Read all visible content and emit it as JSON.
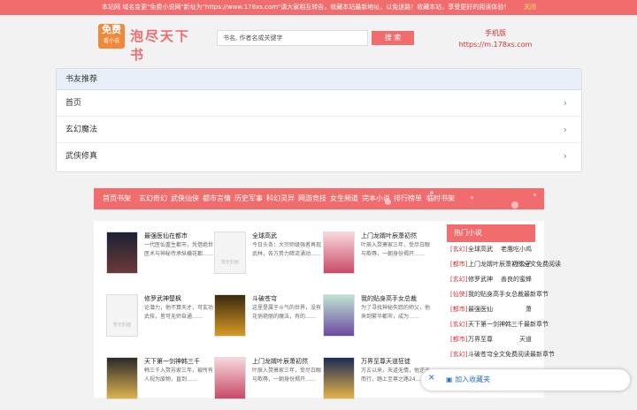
{
  "topbar": {
    "notice": "本站网 域名变更\"免费小说网\"新址为\"https://www.178xs.com\"请大家相互转告，收藏本站最新地址，以免迷路！收藏本站，享受更好的阅读体验！",
    "close": "关闭"
  },
  "logo": {
    "badge_top": "免费",
    "badge_bottom": "看小说",
    "text": "泡尽天下书"
  },
  "search": {
    "placeholder": "书名, 作者名或关键字",
    "button": "搜 索"
  },
  "mobile": {
    "label": "手机版",
    "url": "https://m.178xs.com"
  },
  "panel": {
    "title": "书友推荐",
    "rows": [
      "首页",
      "玄幻魔法",
      "武侠修真"
    ]
  },
  "nav": [
    "首页书架",
    "玄幻奇幻",
    "武侠仙侠",
    "都市言情",
    "历史军事",
    "科幻灵异",
    "网游竞技",
    "女生频道",
    "完本小说",
    "排行榜单",
    "临时书架"
  ],
  "books": [
    {
      "title": "最强医仙在都市",
      "desc": "一代医仙重生都市，凭借绝世医术与神秘传承纵横花都……",
      "cover": "dark"
    },
    {
      "title": "全球高武",
      "desc": "今日头条：大宗师级强者再现武林，各方势力暗流涌动……",
      "cover": "blank"
    },
    {
      "title": "上门龙婿叶辰萧初然",
      "desc": "叶辰入赘萧家三年，受尽白眼与欺辱，一朝身份揭开……",
      "cover": "pink"
    },
    {
      "title": "修罗武神楚枫",
      "desc": "论潜力，他不算天才，可玄功武技，皆可无师自通……",
      "cover": "blank"
    },
    {
      "title": "斗破苍穹",
      "desc": "这里是属于斗气的世界，没有花俏艳丽的魔法，有的……",
      "cover": "gold"
    },
    {
      "title": "我的贴身高手女总裁",
      "desc": "为了寻找神秘失踪的师父，他来到繁华都市，成为……",
      "cover": "green"
    },
    {
      "title": "天下第一剑神韩三千",
      "desc": "韩三千入赘苏家三年，被所有人视为废物，直到……",
      "cover": "dark2"
    },
    {
      "title": "上门龙婿叶辰萧初然",
      "desc": "叶辰入赘萧家三年，受尽白眼与欺辱，一朝身份揭开……",
      "cover": "pink"
    },
    {
      "title": "万界至尊天道狂徒",
      "desc": "万古以来，天道无情，他逆天而行，踏上至尊之路24……",
      "cover": "blue"
    }
  ],
  "cover_blank_text": "暂无封面",
  "side": {
    "title": "热门小说",
    "items": [
      {
        "tag": "[玄幻]",
        "name": "全球高武",
        "author": "老鹰吃小鸡"
      },
      {
        "tag": "[都市]",
        "name": "上门龙婿叶辰萧初然全文免费阅读",
        "author": "叶公子"
      },
      {
        "tag": "[玄幻]",
        "name": "修罗武神",
        "author": "善良的蜜蜂"
      },
      {
        "tag": "[仙侠]",
        "name": "我的贴身高手女总裁最新章节",
        "author": ""
      },
      {
        "tag": "[都市]",
        "name": "最强医仙",
        "author": "萧"
      },
      {
        "tag": "[玄幻]",
        "name": "天下第一剑神韩三千最新章节",
        "author": ""
      },
      {
        "tag": "[都市]",
        "name": "万界至尊",
        "author": "天道"
      },
      {
        "tag": "[玄幻]",
        "name": "斗破苍穹全文免费阅读最新章节",
        "author": ""
      }
    ]
  },
  "fav": {
    "label": "加入收藏夹"
  }
}
